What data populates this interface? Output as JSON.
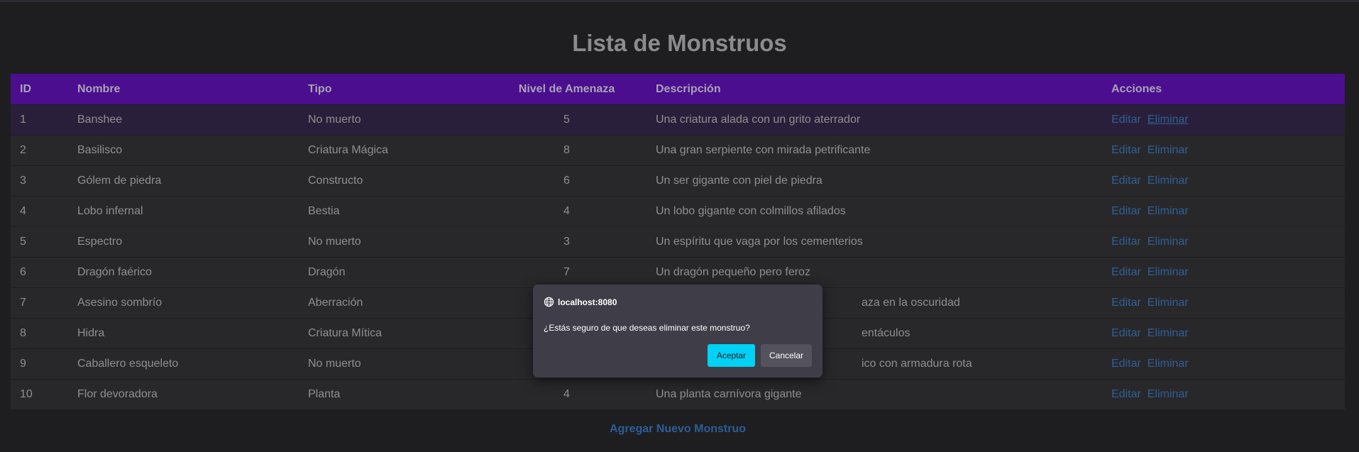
{
  "page": {
    "title": "Lista de Monstruos",
    "add_link": "Agregar Nuevo Monstruo"
  },
  "table": {
    "headers": [
      "ID",
      "Nombre",
      "Tipo",
      "Nivel de Amenaza",
      "Descripción",
      "Acciones"
    ],
    "rows": [
      {
        "id": "1",
        "name": "Banshee",
        "type": "No muerto",
        "threat": "5",
        "description": "Una criatura alada con un grito aterrador"
      },
      {
        "id": "2",
        "name": "Basilisco",
        "type": "Criatura Mágica",
        "threat": "8",
        "description": "Una gran serpiente con mirada petrificante"
      },
      {
        "id": "3",
        "name": "Gólem de piedra",
        "type": "Constructo",
        "threat": "6",
        "description": "Un ser gigante con piel de piedra"
      },
      {
        "id": "4",
        "name": "Lobo infernal",
        "type": "Bestia",
        "threat": "4",
        "description": "Un lobo gigante con colmillos afilados"
      },
      {
        "id": "5",
        "name": "Espectro",
        "type": "No muerto",
        "threat": "3",
        "description": "Un espíritu que vaga por los cementerios"
      },
      {
        "id": "6",
        "name": "Dragón faérico",
        "type": "Dragón",
        "threat": "7",
        "description": "Un dragón pequeño pero feroz"
      },
      {
        "id": "7",
        "name": "Asesino sombrío",
        "type": "Aberración",
        "threat": "",
        "description": "aza en la oscuridad"
      },
      {
        "id": "8",
        "name": "Hidra",
        "type": "Criatura Mítica",
        "threat": "",
        "description": "entáculos"
      },
      {
        "id": "9",
        "name": "Caballero esqueleto",
        "type": "No muerto",
        "threat": "",
        "description": "ico con armadura rota"
      },
      {
        "id": "10",
        "name": "Flor devoradora",
        "type": "Planta",
        "threat": "4",
        "description": "Una planta carnívora gigante"
      }
    ],
    "actions": {
      "edit": "Editar",
      "delete": "Eliminar"
    }
  },
  "dialog": {
    "origin": "localhost:8080",
    "message": "¿Estás seguro de que deseas eliminar este monstruo?",
    "ok_label": "Aceptar",
    "cancel_label": "Cancelar",
    "ok_color": "#00d1f5"
  },
  "colors": {
    "header_bg": "#4b0e8f",
    "link": "#2f5f95"
  }
}
